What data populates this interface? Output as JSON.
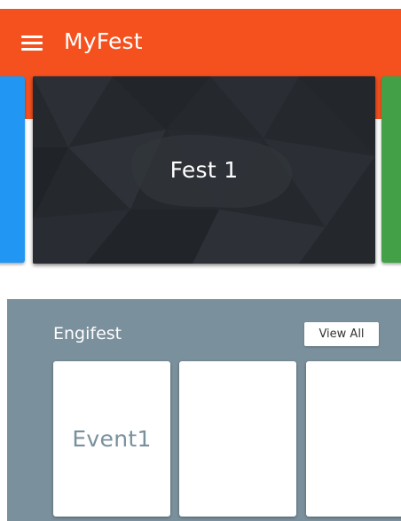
{
  "app": {
    "title": "MyFest",
    "accent_color": "#f4511e",
    "menu_icon": "hamburger-menu-icon"
  },
  "carousel": {
    "cards": [
      {
        "label": "",
        "color": "#2196f3"
      },
      {
        "label": "Fest 1",
        "color": "#25282d"
      },
      {
        "label": "",
        "color": "#43a047"
      }
    ]
  },
  "section": {
    "title": "Engifest",
    "view_all_label": "View All",
    "background_color": "#7a909c",
    "events": [
      {
        "label": "Event1"
      },
      {
        "label": ""
      },
      {
        "label": ""
      }
    ]
  }
}
